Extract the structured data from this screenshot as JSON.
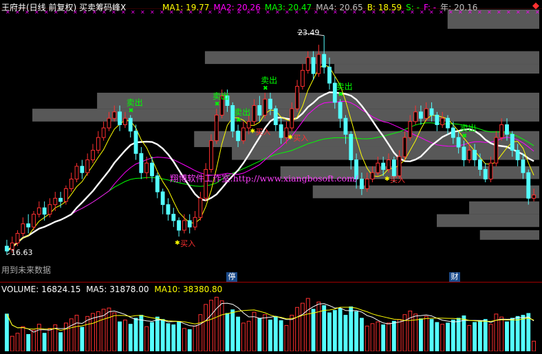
{
  "header": {
    "title": "王府井(日线 前复权) 买卖筹码峰X",
    "indicators": [
      {
        "label": "MA1: 19.77",
        "color": "#ffff00"
      },
      {
        "label": "MA2: 20.26",
        "color": "#ff00ff"
      },
      {
        "label": "MA3: 20.47",
        "color": "#00ff00"
      },
      {
        "label": "MA4: 20.65",
        "color": "#c0c0c0"
      },
      {
        "label": "B: 18.59",
        "color": "#ffff00"
      },
      {
        "label": "S: -",
        "color": "#00ff00"
      },
      {
        "label": "F: -",
        "color": "#ff00ff"
      },
      {
        "label": "年: 20.16",
        "color": "#c0c0c0"
      }
    ],
    "toggle_icon": "diamond-icon"
  },
  "watermark": "翔博软件工作室:http://www.xiangbosoft.com/",
  "notice": "用到未来数据",
  "price_labels": {
    "high": "23.49",
    "low": "16.63"
  },
  "badges": {
    "ting": "停",
    "cai": "财"
  },
  "volume_header": {
    "volume": "VOLUME: 16824.15",
    "ma5": "MA5: 31878.00",
    "ma10": "MA10: 38380.80"
  },
  "colors": {
    "up": "#ff3030",
    "down": "#54ffff",
    "ma1": "#ffff00",
    "ma2": "#ff00ff",
    "ma3": "#00ff00",
    "ma4": "#ffffff",
    "sell": "#00ff00",
    "buy": "#ffff00"
  },
  "chart_data": {
    "type": "candlestick",
    "price_range": [
      16.0,
      24.3
    ],
    "high": 23.49,
    "low": 16.63,
    "candles": [
      [
        16.9,
        16.75,
        17.1,
        16.63
      ],
      [
        16.8,
        17.0,
        17.2,
        16.7
      ],
      [
        17.0,
        17.3,
        17.4,
        16.9
      ],
      [
        17.3,
        17.6,
        17.8,
        17.2
      ],
      [
        17.6,
        17.5,
        17.9,
        17.3
      ],
      [
        17.5,
        17.9,
        18.0,
        17.4
      ],
      [
        17.9,
        18.1,
        18.3,
        17.8
      ],
      [
        18.1,
        17.9,
        18.3,
        17.7
      ],
      [
        17.9,
        18.2,
        18.4,
        17.8
      ],
      [
        18.2,
        18.4,
        18.6,
        18.0
      ],
      [
        18.4,
        18.3,
        18.6,
        18.1
      ],
      [
        18.3,
        18.7,
        18.8,
        18.2
      ],
      [
        18.7,
        19.0,
        19.2,
        18.6
      ],
      [
        19.0,
        19.4,
        19.5,
        18.9
      ],
      [
        19.4,
        19.2,
        19.6,
        19.0
      ],
      [
        19.2,
        19.6,
        19.8,
        19.1
      ],
      [
        19.6,
        19.9,
        20.1,
        19.5
      ],
      [
        19.9,
        20.3,
        20.5,
        19.8
      ],
      [
        20.3,
        20.6,
        20.8,
        20.2
      ],
      [
        20.6,
        20.9,
        21.1,
        20.5
      ],
      [
        20.9,
        21.1,
        21.3,
        20.8
      ],
      [
        21.1,
        20.7,
        21.3,
        20.5
      ],
      [
        20.7,
        20.9,
        21.1,
        20.6
      ],
      [
        20.9,
        20.5,
        21.0,
        20.3
      ],
      [
        20.5,
        19.8,
        20.7,
        19.6
      ],
      [
        19.8,
        19.2,
        20.0,
        19.0
      ],
      [
        19.2,
        19.5,
        19.7,
        19.0
      ],
      [
        19.5,
        19.1,
        19.7,
        18.9
      ],
      [
        19.1,
        18.6,
        19.2,
        18.4
      ],
      [
        18.6,
        18.2,
        18.7,
        17.9
      ],
      [
        18.2,
        17.9,
        18.4,
        17.7
      ],
      [
        17.9,
        17.7,
        18.1,
        17.5
      ],
      [
        17.7,
        17.4,
        17.8,
        17.2
      ],
      [
        17.4,
        17.7,
        17.9,
        17.3
      ],
      [
        17.7,
        17.5,
        17.9,
        17.3
      ],
      [
        17.5,
        17.8,
        18.0,
        17.4
      ],
      [
        17.8,
        18.4,
        18.6,
        17.7
      ],
      [
        18.4,
        19.3,
        19.5,
        18.3
      ],
      [
        19.3,
        20.2,
        20.4,
        19.2
      ],
      [
        20.2,
        21.0,
        21.2,
        20.1
      ],
      [
        21.0,
        21.6,
        21.8,
        20.9
      ],
      [
        21.6,
        21.3,
        21.8,
        21.1
      ],
      [
        21.3,
        20.5,
        21.4,
        20.3
      ],
      [
        20.5,
        20.2,
        20.7,
        20.0
      ],
      [
        20.2,
        20.6,
        20.8,
        20.1
      ],
      [
        20.6,
        20.8,
        21.0,
        20.4
      ],
      [
        20.8,
        21.3,
        21.5,
        20.7
      ],
      [
        21.3,
        21.0,
        21.6,
        20.8
      ],
      [
        21.0,
        21.5,
        21.7,
        20.9
      ],
      [
        21.5,
        21.2,
        21.7,
        21.0
      ],
      [
        21.2,
        20.7,
        21.3,
        20.5
      ],
      [
        20.7,
        20.3,
        20.9,
        20.1
      ],
      [
        20.3,
        20.6,
        20.8,
        20.1
      ],
      [
        20.6,
        21.2,
        21.4,
        20.5
      ],
      [
        21.2,
        21.9,
        22.1,
        21.1
      ],
      [
        21.9,
        22.4,
        22.6,
        21.8
      ],
      [
        22.4,
        22.8,
        23.0,
        22.3
      ],
      [
        22.8,
        22.3,
        23.0,
        22.1
      ],
      [
        22.3,
        22.9,
        23.2,
        22.2
      ],
      [
        22.9,
        22.5,
        23.49,
        22.3
      ],
      [
        22.5,
        22.0,
        22.8,
        21.8
      ],
      [
        22.0,
        21.4,
        22.2,
        21.2
      ],
      [
        21.4,
        20.9,
        21.5,
        20.6
      ],
      [
        20.9,
        20.4,
        21.0,
        20.1
      ],
      [
        20.4,
        19.6,
        20.5,
        19.3
      ],
      [
        19.6,
        19.0,
        19.8,
        18.7
      ],
      [
        19.0,
        18.7,
        19.2,
        18.5
      ],
      [
        18.7,
        19.0,
        19.2,
        18.6
      ],
      [
        19.0,
        19.2,
        19.4,
        18.9
      ],
      [
        19.2,
        19.5,
        19.7,
        19.1
      ],
      [
        19.5,
        19.3,
        19.7,
        19.1
      ],
      [
        19.3,
        19.6,
        19.8,
        19.2
      ],
      [
        19.6,
        19.1,
        19.7,
        18.9
      ],
      [
        19.1,
        19.7,
        19.9,
        19.0
      ],
      [
        19.7,
        20.3,
        20.5,
        19.6
      ],
      [
        20.3,
        20.8,
        21.0,
        20.2
      ],
      [
        20.8,
        21.1,
        21.3,
        20.7
      ],
      [
        21.1,
        20.9,
        21.3,
        20.7
      ],
      [
        20.9,
        21.2,
        21.4,
        20.8
      ],
      [
        21.2,
        21.0,
        21.4,
        20.8
      ],
      [
        21.0,
        20.7,
        21.1,
        20.5
      ],
      [
        20.7,
        20.9,
        21.1,
        20.6
      ],
      [
        20.9,
        20.6,
        21.0,
        20.4
      ],
      [
        20.6,
        20.3,
        20.8,
        20.1
      ],
      [
        20.3,
        20.0,
        20.5,
        19.8
      ],
      [
        20.0,
        19.6,
        20.2,
        19.4
      ],
      [
        19.6,
        19.9,
        20.1,
        19.5
      ],
      [
        19.9,
        19.6,
        20.1,
        19.4
      ],
      [
        19.6,
        19.3,
        19.8,
        19.1
      ],
      [
        19.3,
        19.0,
        19.5,
        18.9
      ],
      [
        19.0,
        19.5,
        19.7,
        18.9
      ],
      [
        19.5,
        20.3,
        20.5,
        19.4
      ],
      [
        20.3,
        20.7,
        20.9,
        20.2
      ],
      [
        20.7,
        20.4,
        20.9,
        20.2
      ],
      [
        20.4,
        19.9,
        20.5,
        19.7
      ],
      [
        19.9,
        19.6,
        20.1,
        19.4
      ],
      [
        19.6,
        19.2,
        19.8,
        19.0
      ],
      [
        19.2,
        18.4,
        19.3,
        18.2
      ],
      [
        18.4,
        18.5,
        18.7,
        18.3
      ]
    ],
    "moving_averages": {
      "MA1": {
        "color": "#ffff00",
        "period": 5
      },
      "MA2": {
        "color": "#ff00ff",
        "period": 20
      },
      "MA3": {
        "color": "#00ff00",
        "period": 40
      },
      "MA4": {
        "color": "#ffffff",
        "period": 13
      }
    },
    "chip_bars": [
      [
        24.3,
        23.7,
        0.17
      ],
      [
        23.0,
        22.6,
        0.62
      ],
      [
        22.6,
        22.3,
        0.38
      ],
      [
        21.7,
        21.2,
        0.82
      ],
      [
        21.2,
        20.8,
        0.94
      ],
      [
        20.5,
        20.0,
        0.64
      ],
      [
        20.0,
        19.6,
        0.57
      ],
      [
        19.4,
        19.0,
        0.48
      ],
      [
        18.8,
        18.4,
        0.42
      ],
      [
        18.3,
        17.9,
        0.13
      ],
      [
        17.9,
        17.5,
        0.19
      ],
      [
        17.4,
        17.1,
        0.11
      ]
    ],
    "sell_signals": [
      {
        "i": 23,
        "text": "卖出"
      },
      {
        "i": 39,
        "text": "卖出"
      },
      {
        "i": 43,
        "text": "卖出"
      },
      {
        "i": 48,
        "text": "卖出"
      },
      {
        "i": 62,
        "text": "卖出"
      },
      {
        "i": 85,
        "text": "卖出"
      },
      {
        "i": 103,
        "text": "卖出"
      }
    ],
    "buy_signals": [
      {
        "i": 32,
        "text": "买入"
      },
      {
        "i": 46,
        "text": "买入"
      },
      {
        "i": 53,
        "text": "买入"
      },
      {
        "i": 71,
        "text": "买入"
      },
      {
        "i": 100,
        "text": "买入"
      },
      {
        "i": 108,
        "text": "买入"
      }
    ],
    "volume": {
      "max": 95000,
      "values": [
        62000,
        25000,
        30000,
        41000,
        28000,
        35000,
        45000,
        30000,
        38000,
        44000,
        31000,
        47000,
        54000,
        60000,
        40000,
        58000,
        63000,
        66000,
        70000,
        72000,
        64000,
        49000,
        52000,
        45000,
        55000,
        60000,
        41000,
        48000,
        57000,
        53000,
        46000,
        44000,
        49000,
        38000,
        36000,
        42000,
        61000,
        78000,
        85000,
        90000,
        84000,
        63000,
        69000,
        57000,
        47000,
        50000,
        65000,
        55000,
        61000,
        52000,
        58000,
        51000,
        43000,
        60000,
        73000,
        80000,
        88000,
        70000,
        82000,
        76000,
        64000,
        68000,
        71000,
        60000,
        74000,
        66000,
        55000,
        42000,
        46000,
        49000,
        44000,
        47000,
        50000,
        53000,
        61000,
        67000,
        62000,
        54000,
        58000,
        53000,
        48000,
        45000,
        47000,
        52000,
        55000,
        59000,
        43000,
        48000,
        51000,
        53000,
        45000,
        62000,
        57000,
        49000,
        55000,
        58000,
        60000,
        63000,
        16824
      ]
    }
  }
}
